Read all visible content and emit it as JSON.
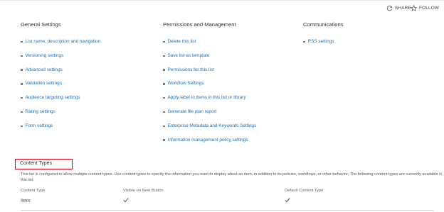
{
  "topbar": {
    "share_label": "SHARE",
    "follow_label": "FOLLOW"
  },
  "columns": [
    {
      "title": "General Settings",
      "links": [
        "List name, description and navigation",
        "Versioning settings",
        "Advanced settings",
        "Validation settings",
        "Audience targeting settings",
        "Rating settings",
        "Form settings"
      ]
    },
    {
      "title": "Permissions and Management",
      "links": [
        "Delete this list",
        "Save list as template",
        "Permissions for this list",
        "Workflow Settings",
        "Apply label to items in this list or library",
        "Generate file plan report",
        "Enterprise Metadata and Keywords Settings",
        "Information management policy settings"
      ]
    },
    {
      "title": "Communications",
      "links": [
        "RSS settings"
      ]
    }
  ],
  "content_types": {
    "title": "Content Types",
    "description": "This list is configured to allow multiple content types. Use content types to specify the information you want to display about an item, in addition to its policies, workflows, or other behavior. The following content types are currently available in this list:",
    "headers": {
      "content_type": "Content Type",
      "visible": "Visible on New Button",
      "default": "Default Content Type"
    },
    "rows": [
      {
        "name": "Item",
        "visible": true,
        "default": true
      }
    ]
  },
  "colors": {
    "link": "#1a6fb5",
    "highlight_box": "#e0000f"
  }
}
